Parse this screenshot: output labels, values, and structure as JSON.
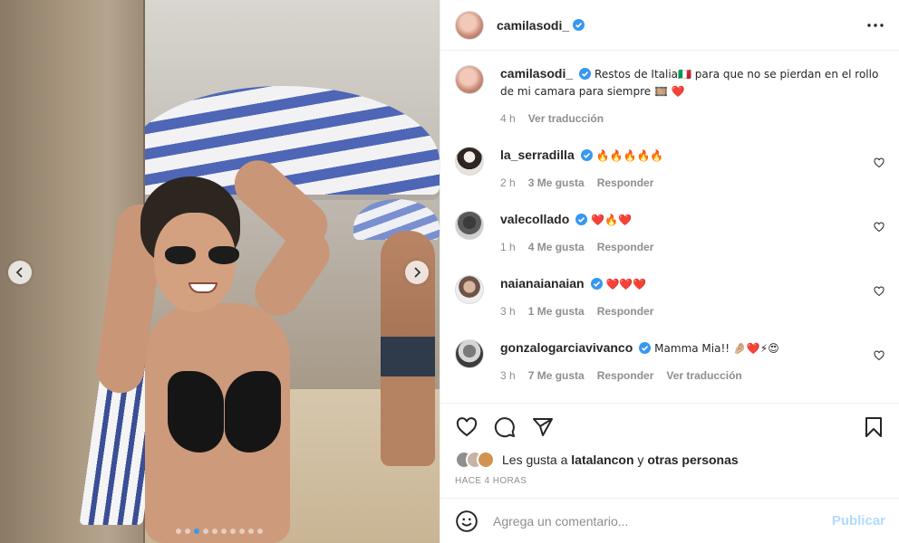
{
  "header": {
    "username": "camilasodi_",
    "verified": true
  },
  "caption": {
    "username": "camilasodi_",
    "text": "Restos de Italia🇮🇹 para que no se pierdan en el rollo de mi camara para siempre 🎞️ ❤️",
    "time": "4 h",
    "translate": "Ver traducción"
  },
  "comments": [
    {
      "username": "la_serradilla",
      "text": "🔥🔥🔥🔥🔥",
      "time": "2 h",
      "likes": "3 Me gusta",
      "reply": "Responder"
    },
    {
      "username": "valecollado",
      "text": "❤️🔥❤️",
      "time": "1 h",
      "likes": "4 Me gusta",
      "reply": "Responder"
    },
    {
      "username": "naianaianaian",
      "text": "❤️❤️❤️",
      "time": "3 h",
      "likes": "1 Me gusta",
      "reply": "Responder"
    },
    {
      "username": "gonzalogarciavivanco",
      "text": "Mamma Mia!! 🤌🏼❤️⚡😍",
      "time": "3 h",
      "likes": "7 Me gusta",
      "reply": "Responder",
      "translate": "Ver traducción"
    }
  ],
  "likes": {
    "prefix": "Les gusta a",
    "user": "latalancon",
    "connector": "y",
    "others": "otras personas"
  },
  "timestamp": "HACE 4 HORAS",
  "add_comment": {
    "placeholder": "Agrega un comentario...",
    "publish": "Publicar"
  },
  "carousel": {
    "count": 10,
    "active_index": 2
  },
  "colors": {
    "accent": "#3797f0",
    "publish_disabled": "#b3dbff",
    "verified": "#3897f0"
  }
}
